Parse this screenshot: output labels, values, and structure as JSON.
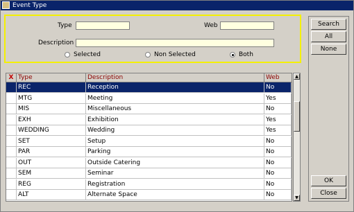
{
  "window": {
    "title": "Event Type"
  },
  "filters": {
    "type_label": "Type",
    "type_value": "",
    "web_label": "Web",
    "web_value": "",
    "description_label": "Description",
    "description_value": "",
    "radios": [
      {
        "label": "Selected",
        "selected": false
      },
      {
        "label": "Non Selected",
        "selected": false
      },
      {
        "label": "Both",
        "selected": true
      }
    ]
  },
  "grid": {
    "headers": {
      "x": "X",
      "type": "Type",
      "description": "Description",
      "web": "Web"
    },
    "rows": [
      {
        "type": "REC",
        "description": "Reception",
        "web": "No",
        "selected": true
      },
      {
        "type": "MTG",
        "description": "Meeting",
        "web": "Yes"
      },
      {
        "type": "MIS",
        "description": "Miscellaneous",
        "web": "No"
      },
      {
        "type": "EXH",
        "description": "Exhibition",
        "web": "Yes"
      },
      {
        "type": "WEDDING",
        "description": "Wedding",
        "web": "Yes"
      },
      {
        "type": "SET",
        "description": "Setup",
        "web": "No"
      },
      {
        "type": "PAR",
        "description": "Parking",
        "web": "No"
      },
      {
        "type": "OUT",
        "description": "Outside Catering",
        "web": "No"
      },
      {
        "type": "SEM",
        "description": "Seminar",
        "web": "No"
      },
      {
        "type": "REG",
        "description": "Registration",
        "web": "No"
      },
      {
        "type": "ALT",
        "description": "Alternate Space",
        "web": "No"
      }
    ]
  },
  "scrollbar": {
    "up_icon": "▲",
    "down_icon": "▼"
  },
  "buttons": {
    "search": "Search",
    "all": "All",
    "none": "None",
    "ok": "OK",
    "close": "Close"
  },
  "colors": {
    "selection": "#0a246a",
    "filter_border": "#f4f000",
    "input_bg": "#ffffe0",
    "header_text": "#8b0000"
  }
}
